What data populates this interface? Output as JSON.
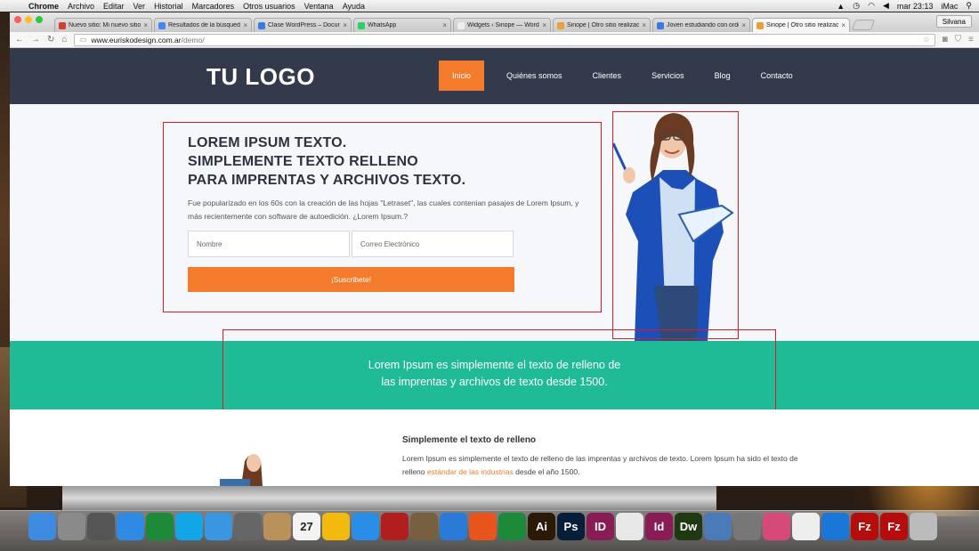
{
  "menubar": {
    "app": "Chrome",
    "items": [
      "Archivo",
      "Editar",
      "Ver",
      "Historial",
      "Marcadores",
      "Otros usuarios",
      "Ventana",
      "Ayuda"
    ],
    "clock": "mar 23:13",
    "computer": "iMac"
  },
  "browser": {
    "tabs": [
      {
        "label": "Nuevo sitio: Mi nuevo sitio",
        "color": "#d23f31"
      },
      {
        "label": "Resultados de la búsqueda",
        "color": "#4285f4"
      },
      {
        "label": "Clase WordPress – Docum",
        "color": "#3b78e7"
      },
      {
        "label": "WhatsApp",
        "color": "#25d366"
      },
      {
        "label": "Widgets ‹ Sinope — WordP",
        "color": "#eeeeee"
      },
      {
        "label": "Sinope | Otro sitio realizad",
        "color": "#e9a03b"
      },
      {
        "label": "Joven estudiando con orde",
        "color": "#3b78e7"
      },
      {
        "label": "Sinope | Otro sitio realizad",
        "color": "#e9a03b"
      }
    ],
    "user": "Silvana",
    "url_host": "www.euriskodesign.com.ar",
    "url_path": "/demo/"
  },
  "site": {
    "logo": "TU LOGO",
    "nav": [
      "Inicio",
      "Quiénes somos",
      "Clientes",
      "Servicios",
      "Blog",
      "Contacto"
    ],
    "hero": {
      "title_l1": "LOREM IPSUM TEXTO.",
      "title_l2": "SIMPLEMENTE TEXTO RELLENO",
      "title_l3": "PARA IMPRENTAS Y ARCHIVOS TEXTO.",
      "desc": "Fue popularizado en los 60s con la creación de las hojas \"Letraset\", las cuales contenian pasajes de Lorem Ipsum, y más recientemente con software de autoedición. ¿Lorem Ipsum.?",
      "name_placeholder": "Nombre",
      "email_placeholder": "Correo Electrónico",
      "button": "¡Suscribete!"
    },
    "band": {
      "line1": "Lorem Ipsum es simplemente el texto de relleno de",
      "line2": "las imprentas y archivos de texto desde 1500."
    },
    "section": {
      "title": "Simplemente el texto de relleno",
      "text_a": "Lorem Ipsum es simplemente el texto de relleno de las imprentas y archivos de texto. Lorem Ipsum ha sido el texto de relleno ",
      "highlight": "estándar de las industrias",
      "text_b": " desde el año 1500."
    }
  },
  "colors": {
    "nav_bg": "#323a4b",
    "accent": "#f47a2c",
    "band": "#1fbb96",
    "annotation": "#e01b22"
  },
  "dock": [
    "finder-icon",
    "launchpad-icon",
    "mission-control-icon",
    "app-store-icon",
    "excel-icon",
    "skype-icon",
    "safari-icon",
    "facetime-icon",
    "contacts-icon",
    "calendar-icon",
    "openoffice-icon",
    "itunes-icon",
    "photo-booth-icon",
    "iphoto-icon",
    "word-icon",
    "powerpoint-icon",
    "excel-icon",
    "illustrator-icon",
    "photoshop-icon",
    "indesign-icon",
    "chrome-icon",
    "indesign-icon",
    "dreamweaver-icon",
    "preview-icon",
    "system-preferences-icon",
    "unknown-icon",
    "textedit-icon",
    "teamviewer-icon",
    "filezilla-icon",
    "filezilla-icon",
    "trash-icon"
  ],
  "dock_labels": {
    "calendar_day": "27",
    "ai": "Ai",
    "ps": "Ps",
    "id": "ID",
    "id2": "Id",
    "dw": "Dw",
    "fz": "Fz"
  }
}
